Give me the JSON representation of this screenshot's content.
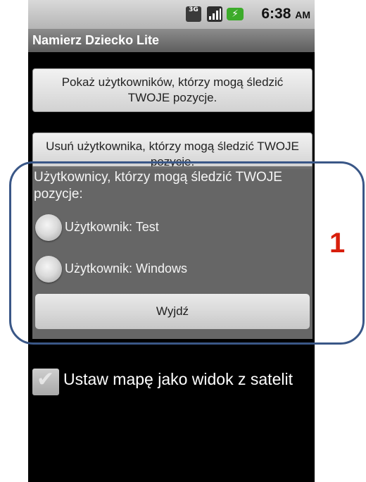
{
  "status_bar": {
    "network": "3G",
    "time": "6:38",
    "ampm": "AM"
  },
  "app": {
    "title": "Namierz Dziecko Lite"
  },
  "buttons": {
    "show_users_line1": "Pokaż użytkowników, którzy mogą śledzić",
    "show_users_line2": "TWOJE pozycje.",
    "remove_user_line1": "Usuń użytkownika, którzy mogą śledzić TWOJE",
    "remove_user_line2": "pozycje."
  },
  "dialog": {
    "title": "Użytkownicy, którzy mogą śledzić TWOJE pozycje:",
    "options": [
      "Użytkownik: Test",
      "Użytkownik: Windows"
    ],
    "exit_label": "Wyjdź"
  },
  "checkbox": {
    "label": "Ustaw mapę jako widok z satelit",
    "checked": true
  },
  "annotation": {
    "marker": "1",
    "color": "#d81f0c",
    "outline_color": "#3a5787"
  }
}
